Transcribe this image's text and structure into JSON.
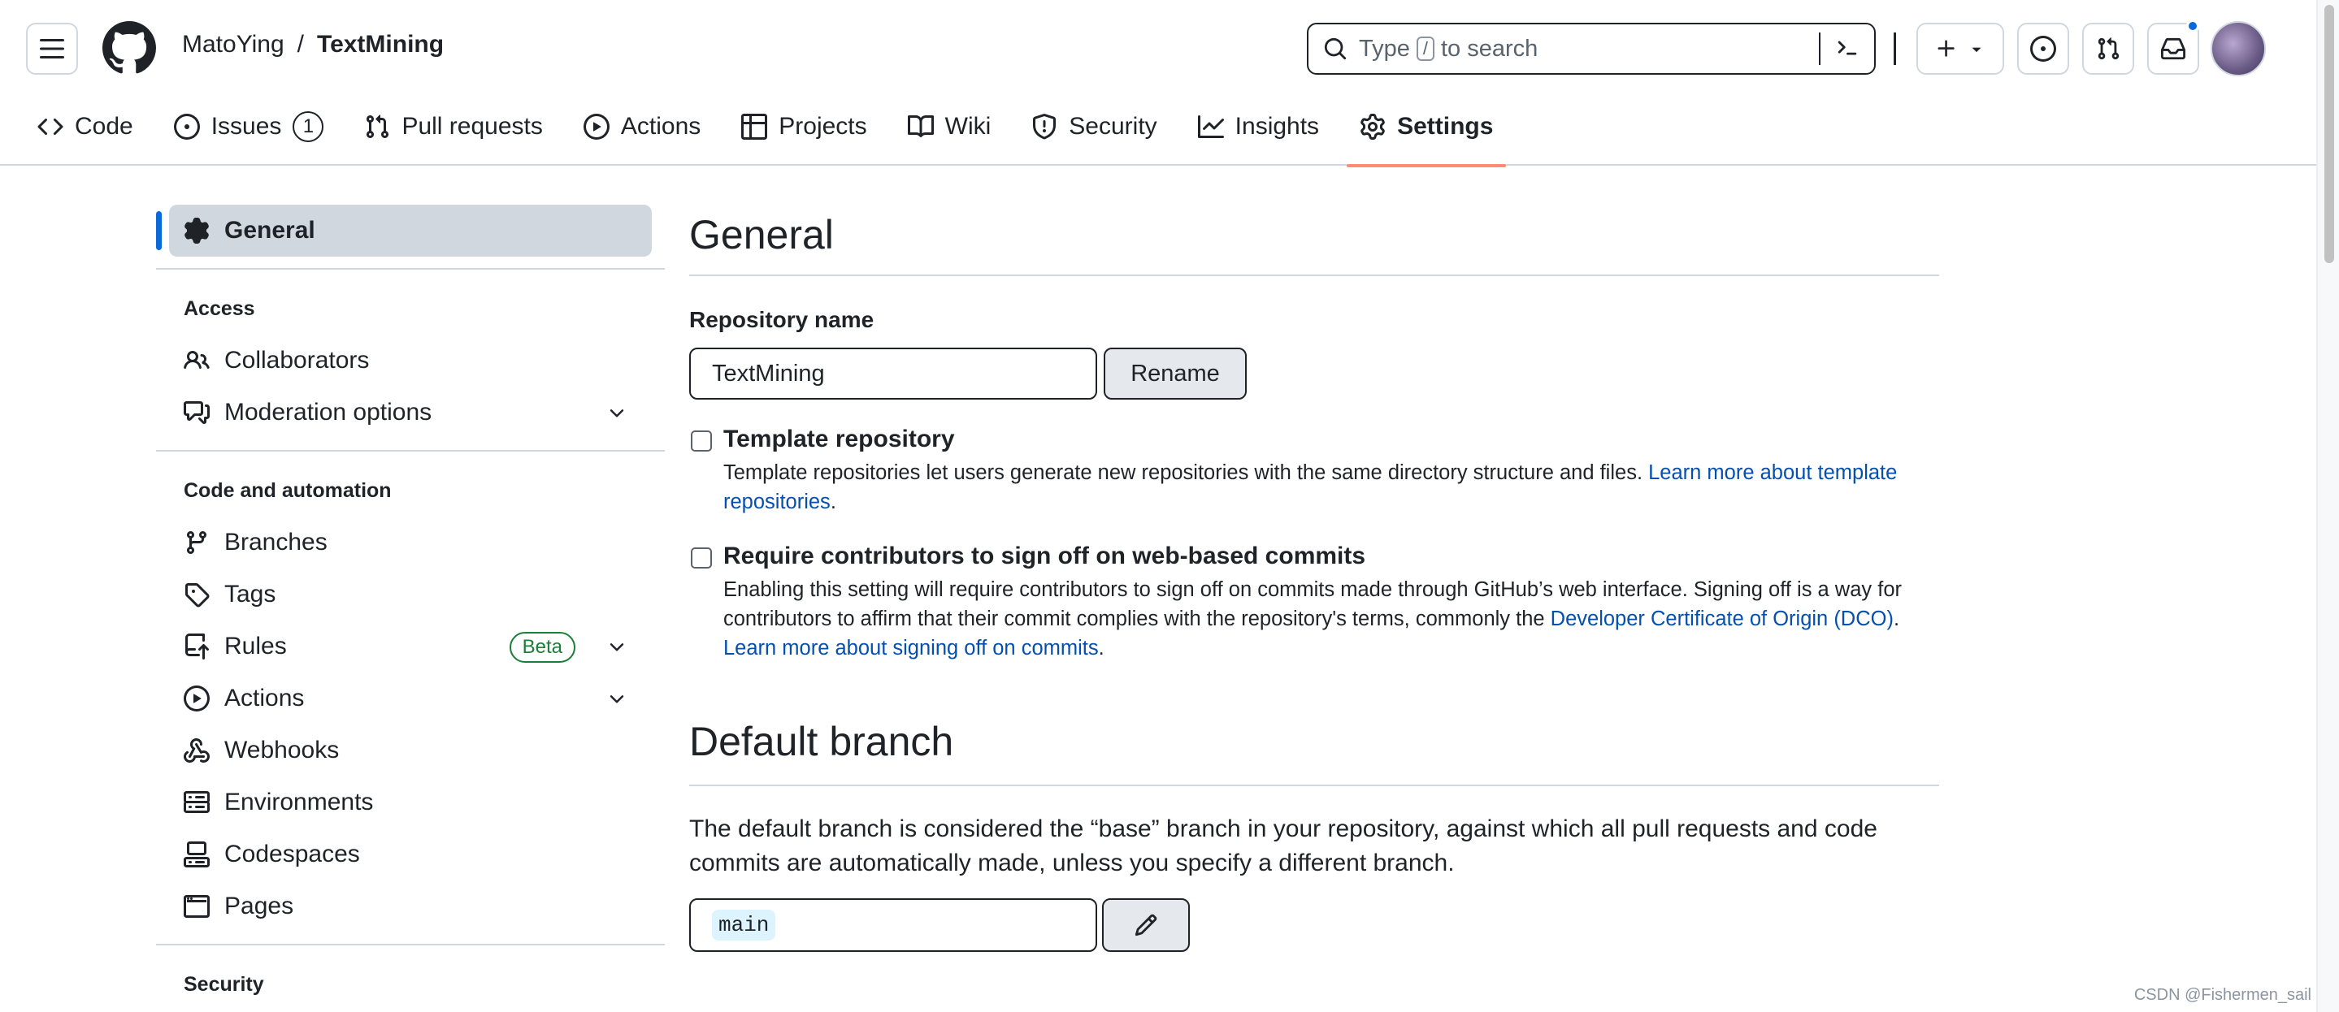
{
  "header": {
    "owner": "MatoYing",
    "separator": "/",
    "repo": "TextMining",
    "search_prefix": "Type",
    "search_key": "/",
    "search_suffix": "to search"
  },
  "tabs": [
    {
      "label": "Code",
      "icon": "code-icon"
    },
    {
      "label": "Issues",
      "icon": "issue-icon",
      "count": "1"
    },
    {
      "label": "Pull requests",
      "icon": "pull-request-icon"
    },
    {
      "label": "Actions",
      "icon": "play-icon"
    },
    {
      "label": "Projects",
      "icon": "table-icon"
    },
    {
      "label": "Wiki",
      "icon": "book-icon"
    },
    {
      "label": "Security",
      "icon": "shield-icon"
    },
    {
      "label": "Insights",
      "icon": "graph-icon"
    },
    {
      "label": "Settings",
      "icon": "gear-icon",
      "selected": true
    }
  ],
  "sidebar": {
    "general": "General",
    "access_heading": "Access",
    "access_items": [
      "Collaborators",
      "Moderation options"
    ],
    "code_heading": "Code and automation",
    "code_items": [
      "Branches",
      "Tags",
      "Rules",
      "Actions",
      "Webhooks",
      "Environments",
      "Codespaces",
      "Pages"
    ],
    "rules_badge": "Beta",
    "security_heading": "Security"
  },
  "main": {
    "title": "General",
    "repo_name_label": "Repository name",
    "repo_name_value": "TextMining",
    "rename_button": "Rename",
    "template": {
      "title": "Template repository",
      "desc": "Template repositories let users generate new repositories with the same directory structure and files.",
      "link": "Learn more about template repositories",
      "end": "."
    },
    "signoff": {
      "title": "Require contributors to sign off on web-based commits",
      "desc1": "Enabling this setting will require contributors to sign off on commits made through GitHub’s web interface. Signing off is a way for contributors to affirm that their commit complies with the repository's terms, commonly the",
      "link1": "Developer Certificate of Origin (DCO)",
      "mid": ".",
      "link2": "Learn more about signing off on commits",
      "end": "."
    },
    "default_branch_title": "Default branch",
    "default_branch_desc": "The default branch is considered the “base” branch in your repository, against which all pull requests and code commits are automatically made, unless you specify a different branch.",
    "default_branch_value": "main"
  },
  "watermark": "CSDN @Fishermen_sail",
  "colors": {
    "accent": "#0969da",
    "link": "#0550ae",
    "tab_underline": "#fd8c73",
    "beta": "#1a7f37"
  }
}
